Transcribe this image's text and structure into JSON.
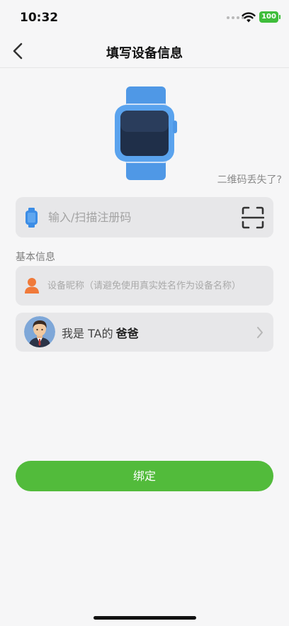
{
  "status_bar": {
    "time": "10:32",
    "battery_level": "100",
    "battery_color": "#3ebd3a"
  },
  "nav": {
    "title": "填写设备信息",
    "back_icon": "chevron-left-icon"
  },
  "device": {
    "image_icon": "smartwatch-icon",
    "qr_lost_link": "二维码丢失了?"
  },
  "registration": {
    "placeholder": "输入/扫描注册码",
    "value": "",
    "icon": "watch-icon",
    "scan_icon": "scan-icon"
  },
  "basic_info": {
    "section_label": "基本信息",
    "nickname_placeholder": "设备昵称（请避免使用真实姓名作为设备名称）",
    "nickname_value": "",
    "nickname_icon": "person-icon"
  },
  "relation": {
    "prefix": "我是 TA的",
    "value": "爸爸",
    "avatar_icon": "father-avatar",
    "chevron_icon": "chevron-right-icon"
  },
  "actions": {
    "bind_label": "绑定",
    "accent_color": "#52bb3b"
  }
}
